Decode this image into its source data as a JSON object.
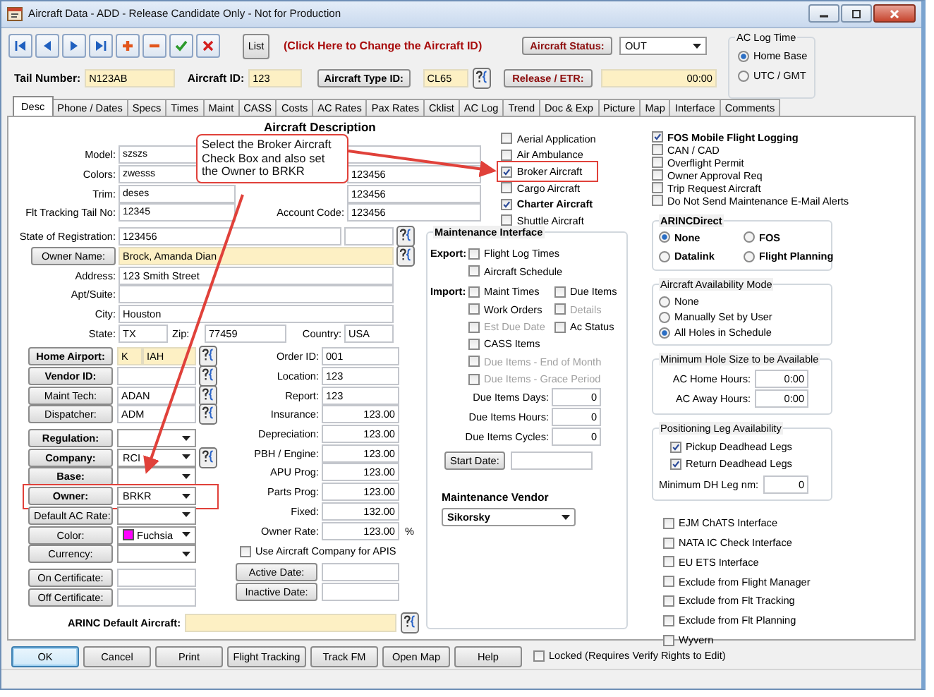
{
  "window": {
    "title": "Aircraft Data - ADD - Release Candidate Only - Not for Production"
  },
  "toolbar": {
    "list_button": "List",
    "change_id_link": "(Click Here to Change the Aircraft ID)",
    "status_button": "Aircraft Status:",
    "status_value": "OUT",
    "tail_label": "Tail Number:",
    "tail_value": "N123AB",
    "id_label": "Aircraft ID:",
    "id_value": "123",
    "type_button": "Aircraft Type ID:",
    "type_value": "CL65",
    "release_button": "Release / ETR:",
    "release_value": "00:00"
  },
  "ac_log_time": {
    "title": "AC Log Time",
    "options": [
      {
        "label": "Home Base",
        "selected": true
      },
      {
        "label": "UTC / GMT",
        "selected": false
      }
    ]
  },
  "tabs": [
    {
      "label": "Desc",
      "selected": true
    },
    {
      "label": "Phone / Dates",
      "selected": false
    },
    {
      "label": "Specs",
      "selected": false
    },
    {
      "label": "Times",
      "selected": false
    },
    {
      "label": "Maint",
      "selected": false
    },
    {
      "label": "CASS",
      "selected": false
    },
    {
      "label": "Costs",
      "selected": false
    },
    {
      "label": "AC Rates",
      "selected": false
    },
    {
      "label": "Pax Rates",
      "selected": false
    },
    {
      "label": "Cklist",
      "selected": false
    },
    {
      "label": "AC Log",
      "selected": false
    },
    {
      "label": "Trend",
      "selected": false
    },
    {
      "label": "Doc & Exp",
      "selected": false
    },
    {
      "label": "Picture",
      "selected": false
    },
    {
      "label": "Map",
      "selected": false
    },
    {
      "label": "Interface",
      "selected": false
    },
    {
      "label": "Comments",
      "selected": false
    }
  ],
  "section_title": "Aircraft Description",
  "description_rows": [
    {
      "label": "Model:",
      "value": "szszs"
    },
    {
      "label": "Colors:",
      "value": "zwesss",
      "side_value": "123456"
    },
    {
      "label": "Trim:",
      "value": "deses",
      "side_value": "123456"
    },
    {
      "label": "Flt Tracking Tail No:",
      "value": "12345",
      "side_label": "Account Code:",
      "side_value": "123456"
    }
  ],
  "registration": {
    "label": "State of Registration:",
    "value": "123456"
  },
  "owner_name": {
    "button": "Owner Name:",
    "value": "Brock, Amanda Dian"
  },
  "address_rows": [
    {
      "label": "Address:",
      "value": "123 Smith Street"
    },
    {
      "label": "Apt/Suite:"
    },
    {
      "label": "City:",
      "value": "Houston"
    }
  ],
  "state_row": {
    "state_label": "State:",
    "state": "TX",
    "zip_label": "Zip:",
    "zip": "77459",
    "country_label": "Country:",
    "country": "USA"
  },
  "left_controls": [
    [
      {
        "button": "Home Airport:",
        "bold": true,
        "kind": "airport",
        "values": [
          "K",
          "IAH"
        ],
        "lookup": true,
        "highlighted": false
      },
      {
        "button": "Vendor ID:",
        "bold": true,
        "kind": "field",
        "lookup": true,
        "highlighted": false
      },
      {
        "button": "Maint Tech:",
        "bold": false,
        "kind": "field",
        "value": "ADAN",
        "lookup": true,
        "highlighted": false
      },
      {
        "button": "Dispatcher:",
        "bold": false,
        "kind": "field",
        "value": "ADM",
        "lookup": true,
        "highlighted": false
      }
    ],
    [
      {
        "button": "Regulation:",
        "bold": true,
        "kind": "dropdown",
        "lookup": false,
        "highlighted": false
      },
      {
        "button": "Company:",
        "bold": true,
        "kind": "dropdown",
        "value": "RCI",
        "lookup": true,
        "highlighted": false
      },
      {
        "button": "Base:",
        "bold": true,
        "kind": "dropdown",
        "lookup": false,
        "highlighted": false
      },
      {
        "button": "Owner:",
        "bold": true,
        "kind": "dropdown",
        "value": "BRKR",
        "lookup": false,
        "highlighted": true
      },
      {
        "button": "Default AC Rate:",
        "bold": false,
        "kind": "dropdown",
        "lookup": false,
        "highlighted": false
      },
      {
        "button": "Color:",
        "bold": false,
        "kind": "color",
        "value": "Fuchsia",
        "color": "#ff00ff",
        "lookup": false,
        "highlighted": false
      },
      {
        "button": "Currency:",
        "bold": false,
        "kind": "dropdown",
        "lookup": false,
        "highlighted": false
      }
    ],
    [
      {
        "button": "On Certificate:",
        "bold": false,
        "kind": "field",
        "lookup": false,
        "highlighted": false
      },
      {
        "button": "Off Certificate:",
        "bold": false,
        "kind": "field",
        "lookup": false,
        "highlighted": false
      }
    ]
  ],
  "rates": [
    {
      "label": "Order ID:",
      "value": "001",
      "kind": "text"
    },
    {
      "label": "Location:",
      "value": "123",
      "kind": "text"
    },
    {
      "label": "Report:",
      "value": "123",
      "kind": "text"
    },
    {
      "label": "Insurance:",
      "value": "123.00",
      "kind": "amount"
    },
    {
      "label": "Depreciation:",
      "value": "123.00",
      "kind": "amount"
    },
    {
      "label": "PBH / Engine:",
      "value": "123.00",
      "kind": "amount"
    },
    {
      "label": "APU Prog:",
      "value": "123.00",
      "kind": "amount"
    },
    {
      "label": "Parts Prog:",
      "value": "123.00",
      "kind": "amount"
    },
    {
      "label": "Fixed:",
      "value": "132.00",
      "kind": "amount"
    },
    {
      "label": "Owner Rate:",
      "value": "123.00",
      "kind": "amount",
      "suffix": "%"
    }
  ],
  "apis_checkbox": {
    "label": "Use Aircraft Company for APIS",
    "checked": false
  },
  "date_buttons": [
    "Active Date:",
    "Inactive Date:"
  ],
  "arinc_default": {
    "label": "ARINC Default Aircraft:"
  },
  "aircraft_flags": [
    {
      "label": "Aerial Application",
      "checked": false,
      "bold": false,
      "highlighted": false
    },
    {
      "label": "Air Ambulance",
      "checked": false,
      "bold": false,
      "highlighted": false
    },
    {
      "label": "Broker Aircraft",
      "checked": true,
      "bold": false,
      "highlighted": true
    },
    {
      "label": "Cargo Aircraft",
      "checked": false,
      "bold": false,
      "highlighted": false
    },
    {
      "label": "Charter Aircraft",
      "checked": true,
      "bold": true,
      "highlighted": false
    },
    {
      "label": "Shuttle Aircraft",
      "checked": false,
      "bold": false,
      "highlighted": false
    }
  ],
  "maintenance": {
    "title": "Maintenance Interface",
    "export_label": "Export:",
    "export": [
      {
        "label": "Flight Log Times",
        "checked": false,
        "disabled": false
      },
      {
        "label": "Aircraft Schedule",
        "checked": false,
        "disabled": false
      }
    ],
    "import_label": "Import:",
    "import_rows": [
      [
        {
          "label": "Maint Times",
          "checked": false,
          "disabled": false
        },
        {
          "label": "Due Items",
          "checked": false,
          "disabled": false
        }
      ],
      [
        {
          "label": "Work Orders",
          "checked": false,
          "disabled": false
        },
        {
          "label": "Details",
          "checked": false,
          "disabled": true
        }
      ],
      [
        {
          "label": "Est Due Date",
          "checked": false,
          "disabled": true
        },
        {
          "label": "Ac Status",
          "checked": false,
          "disabled": false
        }
      ],
      [
        {
          "label": "CASS Items",
          "checked": false,
          "disabled": false
        }
      ],
      [
        {
          "label": "Due Items - End of Month",
          "checked": false,
          "disabled": true
        }
      ],
      [
        {
          "label": "Due Items - Grace Period",
          "checked": false,
          "disabled": true
        }
      ]
    ],
    "counters": [
      {
        "label": "Due Items Days:",
        "value": "0"
      },
      {
        "label": "Due Items Hours:",
        "value": "0"
      },
      {
        "label": "Due Items Cycles:",
        "value": "0"
      }
    ],
    "start_date_button": "Start Date:"
  },
  "maintenance_vendor": {
    "title": "Maintenance Vendor",
    "value": "Sikorsky"
  },
  "options": [
    {
      "label": "FOS Mobile Flight Logging",
      "checked": true,
      "bold": true
    },
    {
      "label": "CAN / CAD",
      "checked": false,
      "bold": false
    },
    {
      "label": "Overflight Permit",
      "checked": false,
      "bold": false
    },
    {
      "label": "Owner Approval Req",
      "checked": false,
      "bold": false
    },
    {
      "label": "Trip Request Aircraft",
      "checked": false,
      "bold": false
    },
    {
      "label": "Do Not Send Maintenance E-Mail Alerts",
      "checked": false,
      "bold": false
    }
  ],
  "arinc_direct": {
    "title": "ARINCDirect",
    "options": [
      {
        "label": "None",
        "selected": true
      },
      {
        "label": "FOS",
        "selected": false
      },
      {
        "label": "Datalink",
        "selected": false
      },
      {
        "label": "Flight Planning",
        "selected": false
      }
    ]
  },
  "availability": {
    "title": "Aircraft Availability Mode",
    "options": [
      {
        "label": "None",
        "selected": false
      },
      {
        "label": "Manually Set by User",
        "selected": false
      },
      {
        "label": "All Holes in Schedule",
        "selected": true
      }
    ]
  },
  "min_hole": {
    "title": "Minimum Hole Size to be Available",
    "rows": [
      {
        "label": "AC Home Hours:",
        "value": "0:00"
      },
      {
        "label": "AC Away Hours:",
        "value": "0:00"
      }
    ]
  },
  "positioning": {
    "title": "Positioning Leg Availability",
    "options": [
      {
        "label": "Pickup Deadhead Legs",
        "checked": true
      },
      {
        "label": "Return Deadhead Legs",
        "checked": true
      }
    ],
    "min_label": "Minimum DH Leg nm:",
    "min_value": "0"
  },
  "interfaces": [
    {
      "label": "EJM ChATS Interface",
      "checked": false
    },
    {
      "label": "NATA IC Check Interface",
      "checked": false
    },
    {
      "label": "EU ETS Interface",
      "checked": false
    },
    {
      "label": "Exclude from Flight Manager",
      "checked": false
    },
    {
      "label": "Exclude from Flt Tracking",
      "checked": false
    },
    {
      "label": "Exclude from Flt Planning",
      "checked": false
    },
    {
      "label": "Wyvern",
      "checked": false
    }
  ],
  "footer": {
    "buttons": [
      {
        "label": "OK",
        "default": true
      },
      {
        "label": "Cancel",
        "default": false
      },
      {
        "label": "Print",
        "default": false
      },
      {
        "label": "Flight Tracking",
        "default": false
      },
      {
        "label": "Track FM",
        "default": false
      },
      {
        "label": "Open Map",
        "default": false
      },
      {
        "label": "Help",
        "default": false
      }
    ],
    "locked": {
      "label": "Locked (Requires Verify Rights to Edit)",
      "checked": false
    }
  },
  "callout": {
    "text": "Select the Broker Aircraft Check Box and also set the Owner to BRKR"
  }
}
